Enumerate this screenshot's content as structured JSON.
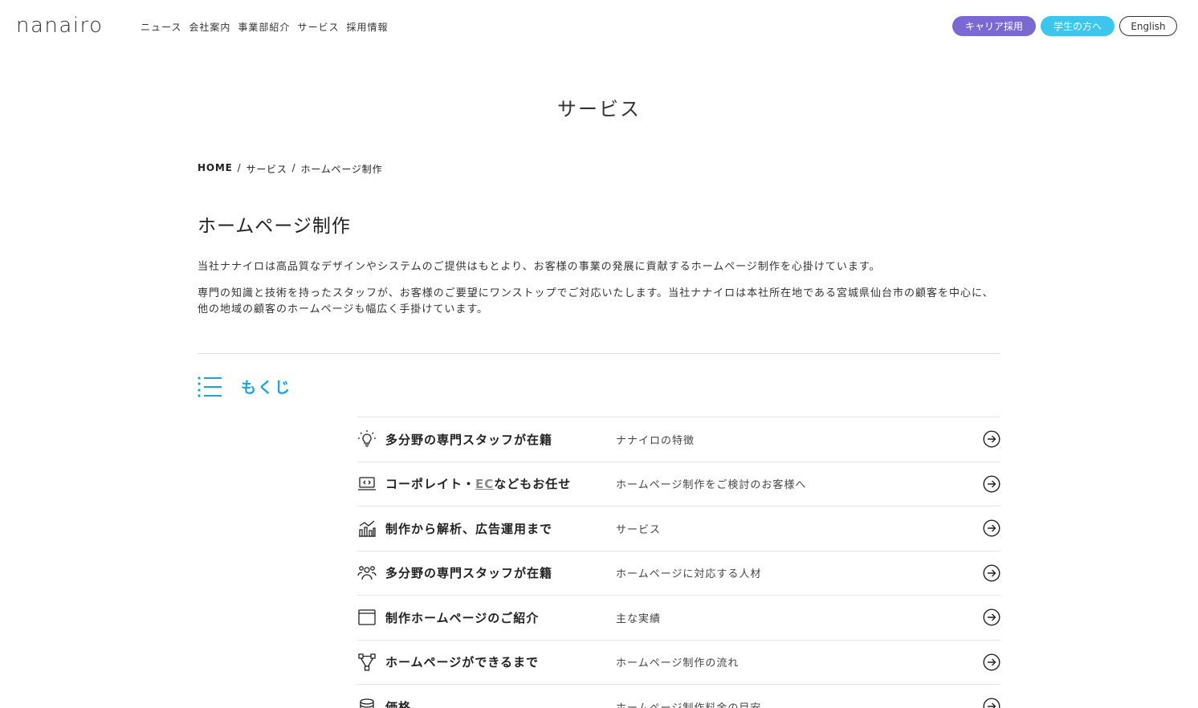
{
  "header": {
    "logo": "nanairo",
    "nav": [
      "ニュース",
      "会社案内",
      "事業部紹介",
      "サービス",
      "採用情報"
    ],
    "career_button": "キャリア採用",
    "student_button": "学生の方へ",
    "english_button": "English",
    "colors": {
      "career": "#7b68d3",
      "student": "#3cc6ec"
    }
  },
  "page_heading": "サービス",
  "breadcrumb": {
    "home": "HOME",
    "sep": "/",
    "service": "サービス",
    "current": "ホームページ制作"
  },
  "article": {
    "title": "ホームページ制作",
    "p1": "当社ナナイロは高品質なデザインやシステムのご提供はもとより、お客様の事業の発展に貢献するホームページ制作を心掛けています。",
    "p2": "専門の知識と技術を持ったスタッフが、お客様のご要望にワンストップでご対応いたします。当社ナナイロは本社所在地である宮城県仙台市の顧客を中心に、他の地域の顧客のホームページも幅広く手掛けています。"
  },
  "toc": {
    "label": "もくじ",
    "accent": "#1aa3df",
    "items": [
      {
        "icon": "lightbulb-icon",
        "title": "多分野の専門スタッフが在籍",
        "sub": "ナナイロの特徴"
      },
      {
        "icon": "laptop-code-icon",
        "title_pre": "コーポレイト・",
        "title_ec": "EC",
        "title_post": "などもお任せ",
        "sub": "ホームページ制作をご検討のお客様へ"
      },
      {
        "icon": "analytics-chart-icon",
        "title": "制作から解析、広告運用まで",
        "sub": "サービス"
      },
      {
        "icon": "team-people-icon",
        "title": "多分野の専門スタッフが在籍",
        "sub": "ホームページに対応する人材"
      },
      {
        "icon": "browser-window-icon",
        "title": "制作ホームページのご紹介",
        "sub": "主な実績"
      },
      {
        "icon": "flow-nodes-icon",
        "title": "ホームページができるまで",
        "sub": "ホームページ制作の流れ"
      },
      {
        "icon": "coins-icon",
        "title": "価格",
        "sub": "ホームページ制作料金の目安"
      }
    ]
  }
}
